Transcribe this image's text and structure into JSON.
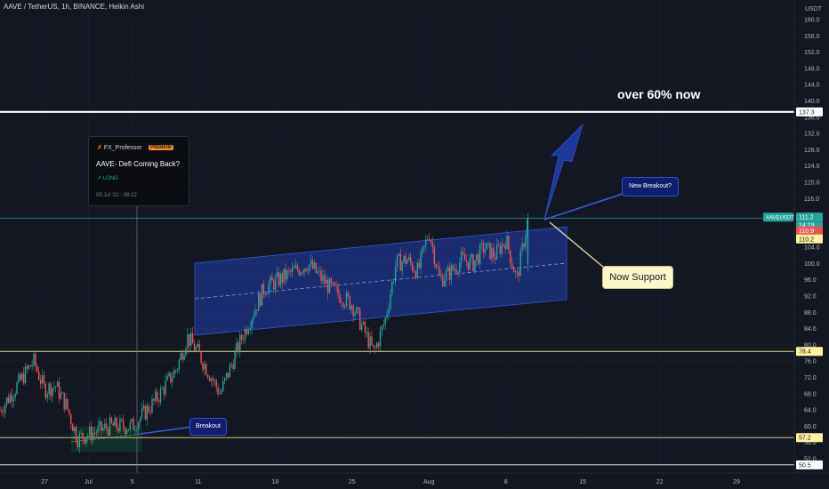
{
  "header": {
    "title": "AAVE / TetherUS, 1h, BINANCE, Heikin Ashi"
  },
  "axis": {
    "currency": "USDT"
  },
  "idea_card": {
    "author": "FX_Professor",
    "badge": "PREMIUM",
    "title": "AAVE- Defi Coming Back?",
    "direction": "↗ LONG",
    "date": "05 Jul '22 - 08:22"
  },
  "annotations": {
    "headline": "over 60% now",
    "new_breakout": "New Breakout?",
    "now_support": "Now Support",
    "breakout": "Breakout"
  },
  "price_labels": {
    "symbol": "AAVEUSDT",
    "last": "111.2",
    "countdown": "14:19",
    "red": "110.9",
    "yellow": "110.2",
    "level_top": "137.3",
    "level_78": "78.4",
    "level_57": "57.2",
    "level_50": "50.5"
  },
  "colors": {
    "background": "#131722",
    "up": "#26a69a",
    "down": "#ef5350",
    "channel": "#1e3a9e",
    "arrow": "#1e40af",
    "level_yellow": "#e8e08a",
    "level_white": "#ffffff",
    "last_price": "#26a69a"
  },
  "chart_data": {
    "type": "candlestick",
    "title": "AAVE / TetherUS, 1h, BINANCE, Heikin Ashi",
    "y_axis_unit": "USDT",
    "yticks": [
      52.0,
      56.0,
      60.0,
      64.0,
      68.0,
      72.0,
      76.0,
      80.0,
      84.0,
      88.0,
      92.0,
      96.0,
      100.0,
      104.0,
      108.0,
      112.0,
      116.0,
      120.0,
      124.0,
      128.0,
      132.0,
      136.0,
      140.0,
      144.0,
      148.0,
      152.0,
      156.0,
      160.0
    ],
    "x_tick_labels": [
      "27",
      "Jul",
      "5",
      "11",
      "18",
      "25",
      "Aug",
      "8",
      "15",
      "22",
      "29"
    ],
    "ylim": [
      50.0,
      163.0
    ],
    "horizontal_levels": [
      137.3,
      111.2,
      78.4,
      57.2,
      50.5
    ],
    "price_path_approx": [
      {
        "date": "Jun 24",
        "price": 68
      },
      {
        "date": "Jun 25",
        "price": 72
      },
      {
        "date": "Jun 26",
        "price": 76
      },
      {
        "date": "Jun 27",
        "price": 69
      },
      {
        "date": "Jun 28",
        "price": 70
      },
      {
        "date": "Jun 29",
        "price": 65
      },
      {
        "date": "Jun 30",
        "price": 57
      },
      {
        "date": "Jul 1",
        "price": 58
      },
      {
        "date": "Jul 3",
        "price": 60
      },
      {
        "date": "Jul 5",
        "price": 60
      },
      {
        "date": "Jul 7",
        "price": 66
      },
      {
        "date": "Jul 9",
        "price": 74
      },
      {
        "date": "Jul 10",
        "price": 82
      },
      {
        "date": "Jul 11",
        "price": 78
      },
      {
        "date": "Jul 13",
        "price": 68
      },
      {
        "date": "Jul 15",
        "price": 82
      },
      {
        "date": "Jul 17",
        "price": 94
      },
      {
        "date": "Jul 19",
        "price": 97
      },
      {
        "date": "Jul 21",
        "price": 100
      },
      {
        "date": "Jul 23",
        "price": 94
      },
      {
        "date": "Jul 25",
        "price": 90
      },
      {
        "date": "Jul 26",
        "price": 84
      },
      {
        "date": "Jul 27",
        "price": 78
      },
      {
        "date": "Jul 28",
        "price": 86
      },
      {
        "date": "Jul 29",
        "price": 100
      },
      {
        "date": "Jul 30",
        "price": 101
      },
      {
        "date": "Jul 31",
        "price": 98
      },
      {
        "date": "Aug 1",
        "price": 108
      },
      {
        "date": "Aug 2",
        "price": 96
      },
      {
        "date": "Aug 3",
        "price": 98
      },
      {
        "date": "Aug 4",
        "price": 101
      },
      {
        "date": "Aug 5",
        "price": 100
      },
      {
        "date": "Aug 6",
        "price": 104
      },
      {
        "date": "Aug 7",
        "price": 102
      },
      {
        "date": "Aug 8",
        "price": 106
      },
      {
        "date": "Aug 9",
        "price": 96
      },
      {
        "date": "Aug 10",
        "price": 111
      }
    ],
    "channel": {
      "upper": [
        {
          "date": "Jul 9",
          "price": 100
        },
        {
          "date": "Aug 12",
          "price": 110
        }
      ],
      "lower": [
        {
          "date": "Jul 9",
          "price": 83
        },
        {
          "date": "Aug 12",
          "price": 91
        }
      ]
    }
  }
}
